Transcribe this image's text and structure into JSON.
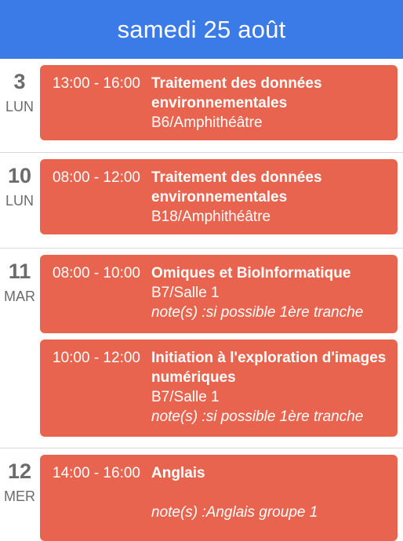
{
  "header": {
    "title": "samedi 25 août"
  },
  "days": [
    {
      "num": "3",
      "name": "LUN",
      "events": [
        {
          "time": "13:00 - 16:00",
          "title": "Traitement des données environnementales",
          "room": "B6/Amphithéâtre",
          "note": ""
        }
      ]
    },
    {
      "num": "10",
      "name": "LUN",
      "events": [
        {
          "time": "08:00 - 12:00",
          "title": "Traitement des données environnementales",
          "room": "B18/Amphithéâtre",
          "note": ""
        }
      ]
    },
    {
      "num": "11",
      "name": "MAR",
      "events": [
        {
          "time": "08:00 - 10:00",
          "title": "Omiques et BioInformatique",
          "room": "B7/Salle 1",
          "note": "note(s) :si possible 1ère tranche"
        },
        {
          "time": "10:00 - 12:00",
          "title": "Initiation à l'exploration d'images numériques",
          "room": "B7/Salle 1",
          "note": "note(s) :si possible 1ère tranche"
        }
      ]
    },
    {
      "num": "12",
      "name": "MER",
      "events": [
        {
          "time": "14:00 - 16:00",
          "title": "Anglais",
          "room": "",
          "note": "note(s) :Anglais groupe 1"
        }
      ]
    }
  ]
}
